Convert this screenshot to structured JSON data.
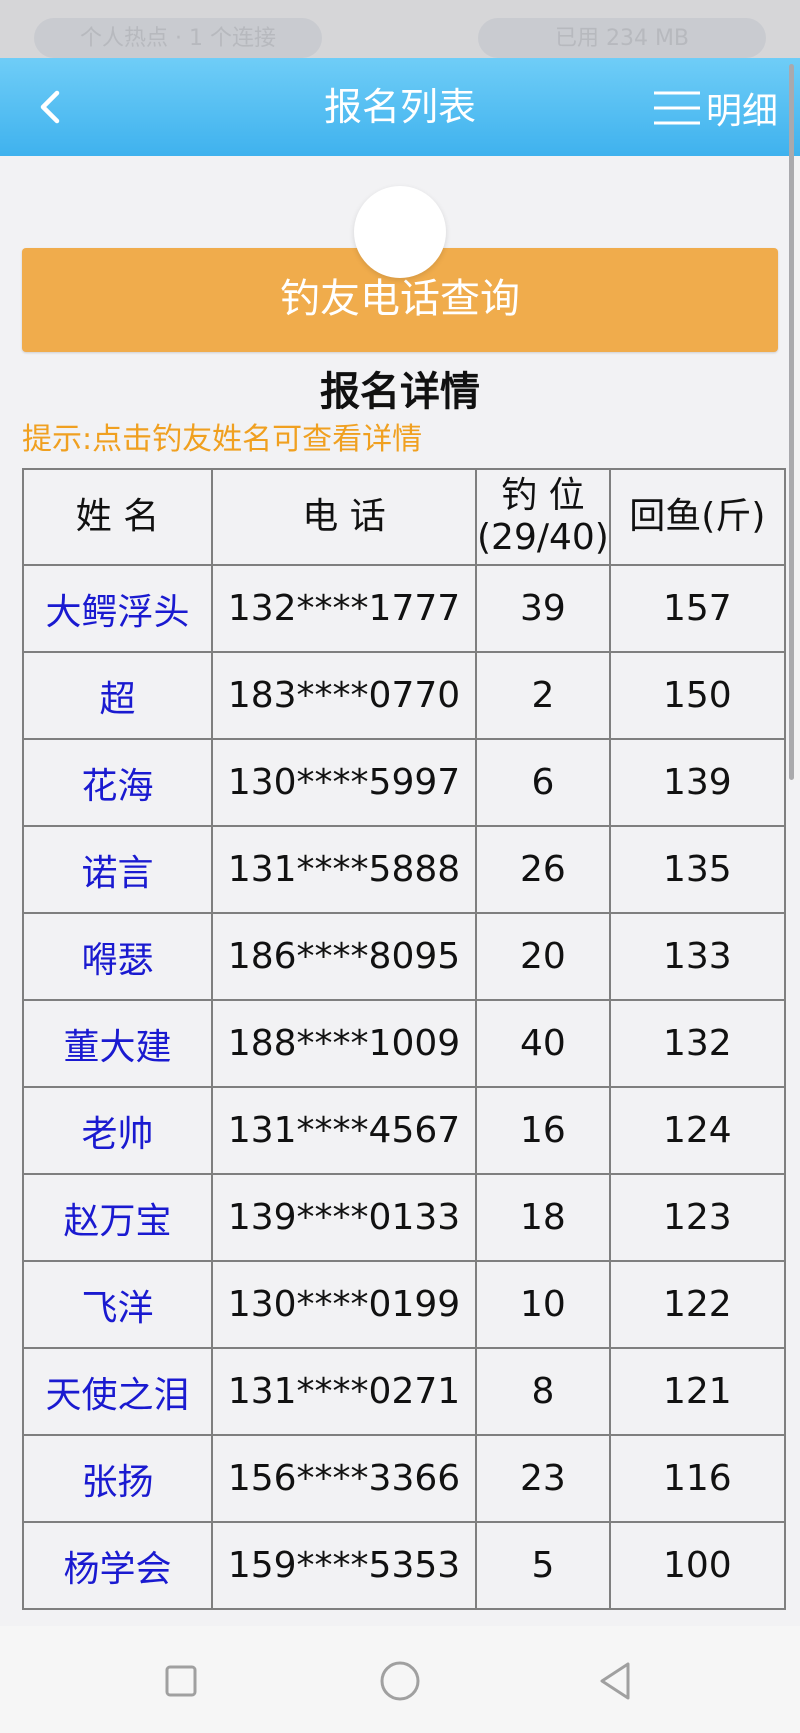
{
  "statusbar": {
    "left_text": "个人热点 · 1 个连接",
    "right_text": "已用 234 MB"
  },
  "header": {
    "title": "报名列表",
    "detail_label": "明细"
  },
  "query_button": "钓友电话查询",
  "section_title": "报名详情",
  "hint": "提示:点击钓友姓名可查看详情",
  "table": {
    "headers": {
      "name": "姓 名",
      "phone": "电 话",
      "seat": "钓 位",
      "seat_count": "(29/40)",
      "catch": "回鱼(斤)"
    },
    "rows": [
      {
        "name": "大鳄浮头",
        "phone": "132****1777",
        "seat": "39",
        "catch": "157"
      },
      {
        "name": "超",
        "phone": "183****0770",
        "seat": "2",
        "catch": "150"
      },
      {
        "name": "花海",
        "phone": "130****5997",
        "seat": "6",
        "catch": "139"
      },
      {
        "name": "诺言",
        "phone": "131****5888",
        "seat": "26",
        "catch": "135"
      },
      {
        "name": "嘚瑟",
        "phone": "186****8095",
        "seat": "20",
        "catch": "133"
      },
      {
        "name": "董大建",
        "phone": "188****1009",
        "seat": "40",
        "catch": "132"
      },
      {
        "name": "老帅",
        "phone": "131****4567",
        "seat": "16",
        "catch": "124"
      },
      {
        "name": "赵万宝",
        "phone": "139****0133",
        "seat": "18",
        "catch": "123"
      },
      {
        "name": "飞洋",
        "phone": "130****0199",
        "seat": "10",
        "catch": "122"
      },
      {
        "name": "天使之泪",
        "phone": "131****0271",
        "seat": "8",
        "catch": "121"
      },
      {
        "name": "张扬",
        "phone": "156****3366",
        "seat": "23",
        "catch": "116"
      },
      {
        "name": "杨学会",
        "phone": "159****5353",
        "seat": "5",
        "catch": "100"
      }
    ]
  },
  "colors": {
    "header_bg": "#4fbdf2",
    "query_button_bg": "#f0ac4c",
    "name_link": "#1a1ad0",
    "hint_text": "#f0a020"
  }
}
